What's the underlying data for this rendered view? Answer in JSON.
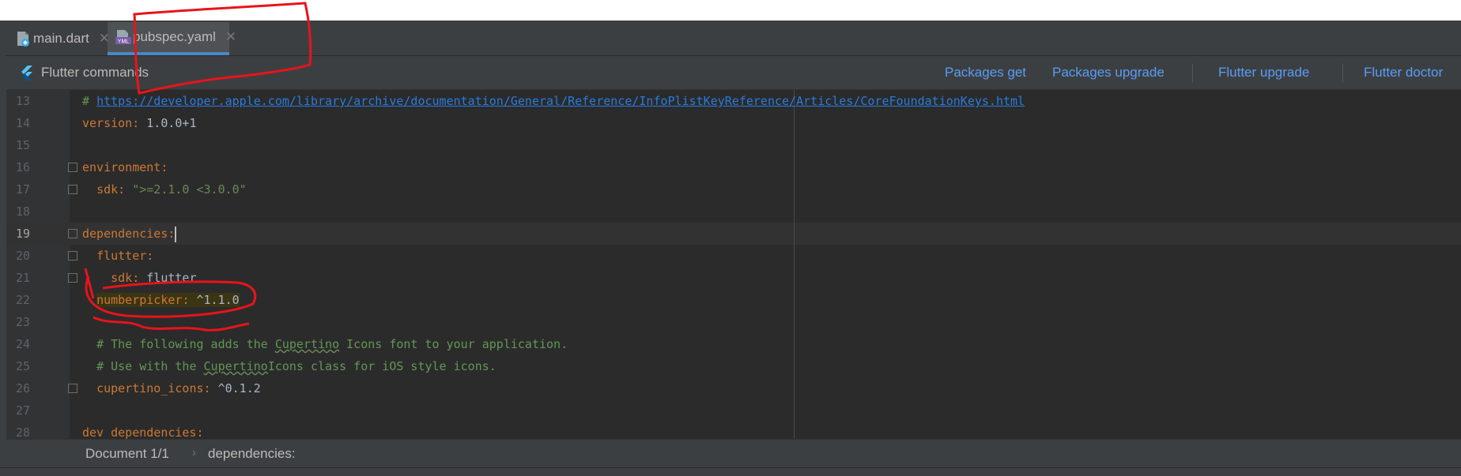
{
  "tabs": [
    {
      "label": "main.dart",
      "icon": "dart-file-icon"
    },
    {
      "label": "pubspec.yaml",
      "icon": "yaml-file-icon",
      "icon_text": "YML"
    }
  ],
  "close_glyph": "✕",
  "commands": {
    "title": "Flutter commands",
    "packages_get": "Packages get",
    "packages_upgrade": "Packages upgrade",
    "flutter_upgrade": "Flutter upgrade",
    "flutter_doctor": "Flutter doctor"
  },
  "editor": {
    "lines": [
      {
        "num": "13",
        "hash": "# ",
        "url": "https://developer.apple.com/library/archive/documentation/General/Reference/InfoPlistKeyReference/Articles/CoreFoundationKeys.html"
      },
      {
        "num": "14",
        "key": "version",
        "value": "1.0.0+1"
      },
      {
        "num": "15"
      },
      {
        "num": "16",
        "key": "environment"
      },
      {
        "num": "17",
        "key": "sdk",
        "value": "\">=2.1.0 <3.0.0\""
      },
      {
        "num": "18"
      },
      {
        "num": "19",
        "key": "dependencies"
      },
      {
        "num": "20",
        "key": "flutter"
      },
      {
        "num": "21",
        "key": "sdk",
        "value": "flutter"
      },
      {
        "num": "22",
        "key": "numberpicker",
        "value": "^1.1.0"
      },
      {
        "num": "23"
      },
      {
        "num": "24",
        "c_pre": "# The following adds the ",
        "c_typo": "Cupertino",
        "c_post": " Icons font to your application."
      },
      {
        "num": "25",
        "c_pre": "# Use with the ",
        "c_typo": "Cupertino",
        "c_post": "Icons class for iOS style icons."
      },
      {
        "num": "26",
        "key": "cupertino_icons",
        "value": "^0.1.2"
      },
      {
        "num": "27"
      },
      {
        "num": "28",
        "key": "dev_dependencies"
      }
    ]
  },
  "status": {
    "document": "Document 1/1",
    "separator": "›",
    "path": "dependencies:"
  },
  "colors": {
    "background": "#2b2b2b",
    "keyword": "#cc7832",
    "string": "#6a8759",
    "link": "#589df6",
    "annotation": "#e8141a"
  }
}
